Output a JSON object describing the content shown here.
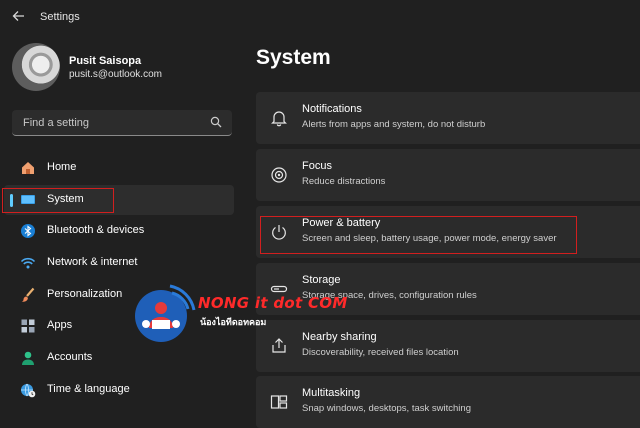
{
  "app": {
    "title": "Settings"
  },
  "user": {
    "name": "Pusit Saisopa",
    "email": "pusit.s@outlook.com"
  },
  "search": {
    "placeholder": "Find a setting"
  },
  "sidebar": {
    "items": [
      {
        "label": "Home",
        "icon": "home-icon"
      },
      {
        "label": "System",
        "icon": "system-icon",
        "active": true
      },
      {
        "label": "Bluetooth & devices",
        "icon": "bluetooth-icon"
      },
      {
        "label": "Network & internet",
        "icon": "wifi-icon"
      },
      {
        "label": "Personalization",
        "icon": "brush-icon"
      },
      {
        "label": "Apps",
        "icon": "apps-icon"
      },
      {
        "label": "Accounts",
        "icon": "accounts-icon"
      },
      {
        "label": "Time & language",
        "icon": "globe-clock-icon"
      }
    ]
  },
  "main": {
    "title": "System",
    "cards": [
      {
        "title": "Notifications",
        "subtitle": "Alerts from apps and system, do not disturb",
        "icon": "bell-icon"
      },
      {
        "title": "Focus",
        "subtitle": "Reduce distractions",
        "icon": "focus-icon"
      },
      {
        "title": "Power & battery",
        "subtitle": "Screen and sleep, battery usage, power mode, energy saver",
        "icon": "power-icon"
      },
      {
        "title": "Storage",
        "subtitle": "Storage space, drives, configuration rules",
        "icon": "storage-icon"
      },
      {
        "title": "Nearby sharing",
        "subtitle": "Discoverability, received files location",
        "icon": "share-icon"
      },
      {
        "title": "Multitasking",
        "subtitle": "Snap windows, desktops, task switching",
        "icon": "multitasking-icon"
      }
    ]
  },
  "watermark": {
    "line1": "NONG it dot COM",
    "line2": "น้องไอทีดอทคอม"
  },
  "colors": {
    "accent": "#60cdff",
    "highlight_box": "#d21f1f",
    "background": "#202020",
    "card": "#2b2b2b"
  }
}
